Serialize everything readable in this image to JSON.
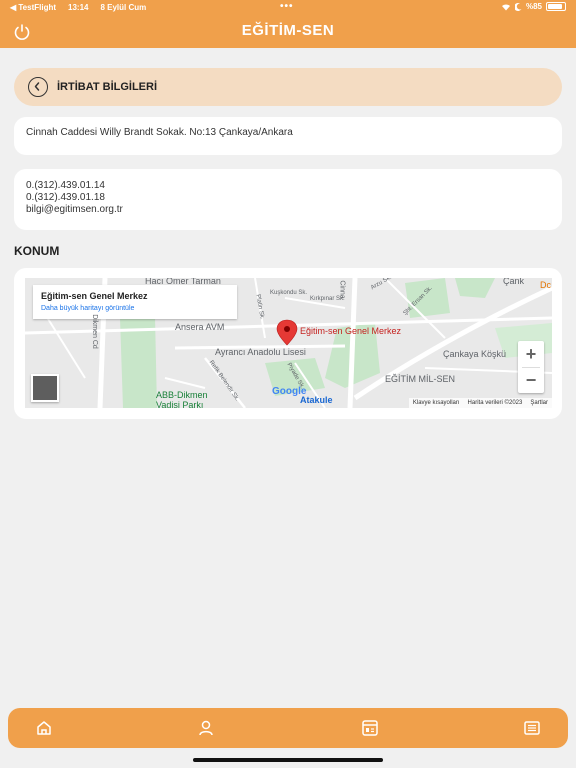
{
  "status_bar": {
    "back_app": "◀ TestFlight",
    "time": "13:14",
    "date": "8 Eylül Cum",
    "dots": "•••",
    "battery_text": "%85",
    "battery_level": 0.85
  },
  "header": {
    "title": "EĞİTİM-SEN",
    "power_icon": "power-icon"
  },
  "section": {
    "title": "İRTİBAT BİLGİLERİ",
    "back_icon": "chevron-left-icon"
  },
  "address": "Cinnah Caddesi Willy Brandt Sokak. No:13 Çankaya/Ankara",
  "contacts": [
    "0.(312).439.01.14",
    "0.(312).439.01.18",
    "bilgi@egitimsen.org.tr"
  ],
  "location": {
    "title": "KONUM",
    "map": {
      "info_title": "Eğitim-sen Genel Merkez",
      "info_link": "Daha büyük haritayı görüntüle",
      "labels": {
        "haci_omer": "Hacı Ömer Tarman",
        "ansera": "Ansera AVM",
        "marker": "Eğitim-sen Genel Merkez",
        "ayranci": "Ayrancı Anadolu Lisesi",
        "cankaya": "Çankaya Köşkü",
        "milsen": "EĞİTİM MİL-SEN",
        "abb": "ABB-Dikmen",
        "vadisi": "Vadisi Parkı",
        "atakule": "Atakule",
        "dikmen_cd": "Dikmen Cd",
        "cinnah": "Cinna",
        "kuskondu": "Kuşkondu Sk.",
        "kirkpinar": "Kırkpınar Sk.",
        "platin": "Platin Sk.",
        "refik": "Refik Belendir Sk.",
        "piyade": "Piyade Sk.",
        "sht_ersan": "Şht. Ersan Sk.",
        "arzu": "Arzu Sk.",
        "cank": "Çank",
        "dc": "Dc"
      },
      "google": "Google",
      "footer": {
        "keyboard": "Klavye kısayolları",
        "data": "Harita verileri ©2023",
        "terms": "Şartlar"
      },
      "zoom_in": "+",
      "zoom_out": "−"
    }
  },
  "tabbar": {
    "icons": [
      "home-icon",
      "user-icon",
      "news-grid-icon",
      "newspaper-icon"
    ]
  },
  "colors": {
    "brand": "#f0a04b",
    "section_bg": "#f4dcc2",
    "page_bg": "#f0f0f0",
    "marker": "#e53935"
  }
}
